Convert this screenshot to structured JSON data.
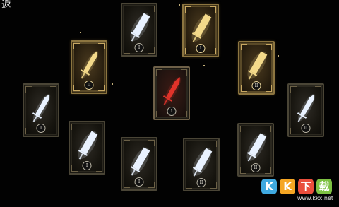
{
  "nav": {
    "back_label": "返"
  },
  "cards": [
    {
      "id": "card-top-left",
      "tier": "I",
      "blade": "broadsword",
      "glow": "none"
    },
    {
      "id": "card-top-right",
      "tier": "I",
      "blade": "broadsword",
      "glow": "gold"
    },
    {
      "id": "card-upper-left",
      "tier": "II",
      "blade": "longsword",
      "glow": "gold"
    },
    {
      "id": "card-upper-right",
      "tier": "II",
      "blade": "broadsword",
      "glow": "gold"
    },
    {
      "id": "card-center",
      "tier": "I",
      "blade": "longsword",
      "glow": "red"
    },
    {
      "id": "card-far-left",
      "tier": "I",
      "blade": "longsword",
      "glow": "none"
    },
    {
      "id": "card-far-right",
      "tier": "II",
      "blade": "longsword",
      "glow": "none"
    },
    {
      "id": "card-lower-left",
      "tier": "I",
      "blade": "broadsword",
      "glow": "none"
    },
    {
      "id": "card-lower-right",
      "tier": "II",
      "blade": "broadsword",
      "glow": "none"
    },
    {
      "id": "card-bottom-left",
      "tier": "I",
      "blade": "broadsword",
      "glow": "none"
    },
    {
      "id": "card-bottom-right",
      "tier": "II",
      "blade": "broadsword",
      "glow": "none"
    }
  ],
  "watermark": {
    "letters": [
      "K",
      "K",
      "下",
      "载"
    ],
    "colors": [
      "#3fa9e0",
      "#f5a623",
      "#e94e3c",
      "#7dc142"
    ],
    "url": "www.kkx.net"
  },
  "colors": {
    "blade_white": "#e9f2ff",
    "blade_gold": "#f3d98a",
    "blade_red": "#e0332a",
    "frame": "#4a4536",
    "frame_gold": "#8c7540"
  }
}
